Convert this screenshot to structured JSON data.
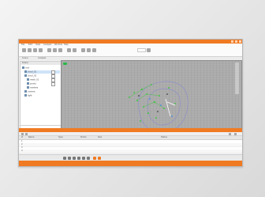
{
  "app": {
    "title": "",
    "accent_color": "#f07a22",
    "menus": [
      "File",
      "Edit",
      "View",
      "Analysis",
      "Window",
      "Help"
    ],
    "ribbon_icons": [
      "open-icon",
      "save-icon",
      "undo-icon",
      "redo-icon",
      "move-icon",
      "rotate-icon",
      "scale-icon",
      "select-icon",
      "measure-icon",
      "filter-icon",
      "view-icon",
      "grid-icon"
    ],
    "tabs": [
      "Scene",
      "Analysis"
    ],
    "tree_panel": {
      "header": "Scene",
      "rows": [
        "root",
        "cloud_01",
        "cloud_02",
        "mesh_01",
        "points",
        "markers",
        "camera",
        "light"
      ]
    },
    "bottom_panel": {
      "title": "",
      "columns": [
        "#",
        "Name",
        "Type",
        "Points",
        "Size",
        "Status"
      ],
      "rows": [
        [
          "1",
          "",
          "",
          "",
          "",
          ""
        ],
        [
          "2",
          "",
          "",
          "",
          "",
          ""
        ],
        [
          "3",
          "",
          "",
          "",
          "",
          ""
        ],
        [
          "4",
          "",
          "",
          "",
          "",
          ""
        ]
      ]
    },
    "statusbar": [
      "",
      "",
      ""
    ]
  }
}
